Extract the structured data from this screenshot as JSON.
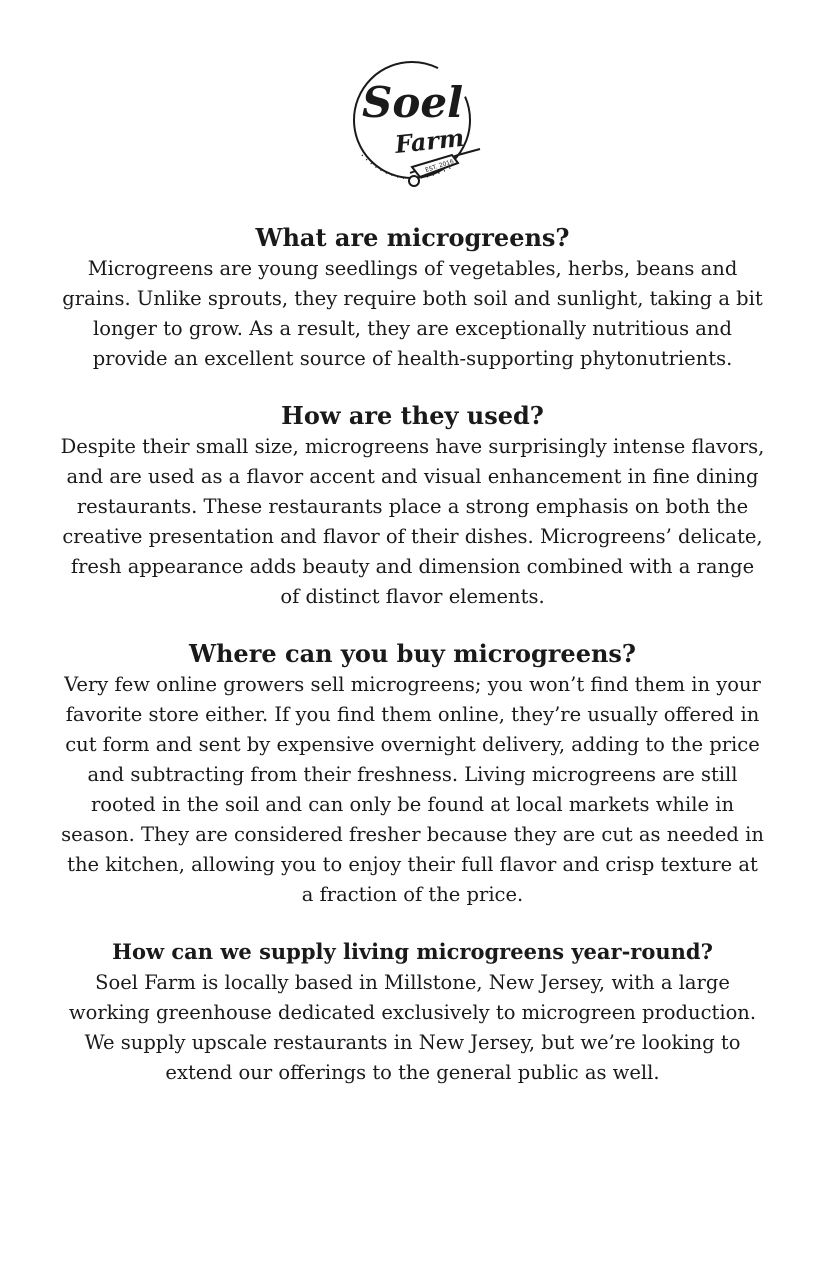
{
  "logo": {
    "line1": "Soel",
    "line2": "Farm",
    "est": "EST. 2016"
  },
  "sections": [
    {
      "heading": "What are microgreens?",
      "body": "Microgreens are young seedlings of vegetables, herbs, beans and grains. Unlike sprouts, they require both soil and sunlight, taking a bit longer to grow. As a result, they are exceptionally nutritious and provide an excellent source of health-supporting phytonutrients."
    },
    {
      "heading": "How are they used?",
      "body": "Despite their small size, microgreens have surprisingly intense flavors, and are used as a flavor accent and visual enhancement in fine dining restaurants. These restaurants place a strong emphasis on both the creative presentation and flavor of their dishes.  Microgreens’ delicate, fresh appearance adds beauty and dimension combined with a range of distinct flavor elements."
    },
    {
      "heading": "Where can you buy microgreens?",
      "body": "Very few online growers sell microgreens; you won’t find them in your favorite store either. If you find them online, they’re usually offered in cut form and sent by expensive overnight delivery, adding to the price and subtracting from their freshness.  Living microgreens are still rooted in the soil and can only be found at local markets while in season. They are considered fresher because they are cut as needed in the kitchen, allowing you to enjoy their full flavor and crisp texture at a fraction of the price."
    },
    {
      "heading": "How can we supply living microgreens year-round?",
      "body": "Soel Farm is locally based in Millstone, New Jersey, with a large working greenhouse dedicated exclusively to microgreen production. We supply upscale restaurants in New Jersey, but we’re looking to extend our offerings to the general public as well."
    }
  ]
}
